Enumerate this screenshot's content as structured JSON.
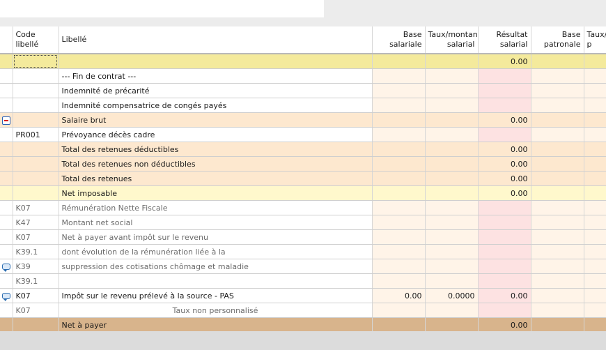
{
  "colors": {
    "summary_yellow_row": "#f4ea9c",
    "total_row_peach": "#fde8cf",
    "net_imposable_row": "#fff8cc",
    "net_a_payer_row": "#d8b48c",
    "base_col_tint": "#fff4e8",
    "result_col_pink": "#fde2e2"
  },
  "columns": [
    {
      "label": "Code\nlibellé"
    },
    {
      "label": "Libellé"
    },
    {
      "label": "Base\nsalariale"
    },
    {
      "label": "Taux/montant\nsalarial"
    },
    {
      "label": "Résultat\nsalarial"
    },
    {
      "label": "Base\npatronale"
    },
    {
      "label": "Taux/m\np"
    }
  ],
  "rows": [
    {
      "icon": "",
      "code": "",
      "label": "",
      "base_sal": "",
      "taux_sal": "",
      "result_sal": "0.00",
      "style": "summary-yellow",
      "label_align": "left"
    },
    {
      "icon": "",
      "code": "",
      "label": "--- Fin de contrat ---",
      "base_sal": "",
      "taux_sal": "",
      "result_sal": "",
      "style": "normal",
      "label_align": "left"
    },
    {
      "icon": "",
      "code": "",
      "label": "Indemnité de précarité",
      "base_sal": "",
      "taux_sal": "",
      "result_sal": "",
      "style": "normal",
      "label_align": "left"
    },
    {
      "icon": "",
      "code": "",
      "label": "Indemnité compensatrice de congés payés",
      "base_sal": "",
      "taux_sal": "",
      "result_sal": "",
      "style": "normal",
      "label_align": "left"
    },
    {
      "icon": "collapse-icon",
      "code": "",
      "label": "Salaire brut",
      "base_sal": "",
      "taux_sal": "",
      "result_sal": "0.00",
      "style": "total",
      "label_align": "left"
    },
    {
      "icon": "",
      "code": "PR001",
      "label": "Prévoyance décès cadre",
      "base_sal": "",
      "taux_sal": "",
      "result_sal": "",
      "style": "normal",
      "label_align": "left"
    },
    {
      "icon": "",
      "code": "",
      "label": "Total des retenues déductibles",
      "base_sal": "",
      "taux_sal": "",
      "result_sal": "0.00",
      "style": "total",
      "label_align": "left"
    },
    {
      "icon": "",
      "code": "",
      "label": "Total des retenues non déductibles",
      "base_sal": "",
      "taux_sal": "",
      "result_sal": "0.00",
      "style": "total",
      "label_align": "left"
    },
    {
      "icon": "",
      "code": "",
      "label": "Total des retenues",
      "base_sal": "",
      "taux_sal": "",
      "result_sal": "0.00",
      "style": "total",
      "label_align": "left"
    },
    {
      "icon": "",
      "code": "",
      "label": "Net imposable",
      "base_sal": "",
      "taux_sal": "",
      "result_sal": "0.00",
      "style": "net-imposable",
      "label_align": "left"
    },
    {
      "icon": "",
      "code": "K07",
      "label": "Rémunération Nette Fiscale",
      "base_sal": "",
      "taux_sal": "",
      "result_sal": "",
      "style": "grey",
      "label_align": "left"
    },
    {
      "icon": "",
      "code": "K47",
      "label": "Montant net social",
      "base_sal": "",
      "taux_sal": "",
      "result_sal": "",
      "style": "grey",
      "label_align": "left"
    },
    {
      "icon": "",
      "code": "K07",
      "label": "Net à payer avant impôt sur le revenu",
      "base_sal": "",
      "taux_sal": "",
      "result_sal": "",
      "style": "grey",
      "label_align": "left"
    },
    {
      "icon": "",
      "code": "K39.1",
      "label": "dont évolution de la rémunération liée à la",
      "base_sal": "",
      "taux_sal": "",
      "result_sal": "",
      "style": "grey",
      "label_align": "left"
    },
    {
      "icon": "comment-icon",
      "code": "K39",
      "label": "suppression des cotisations chômage et maladie",
      "base_sal": "",
      "taux_sal": "",
      "result_sal": "",
      "style": "grey",
      "label_align": "left"
    },
    {
      "icon": "",
      "code": "K39.1",
      "label": "",
      "base_sal": "",
      "taux_sal": "",
      "result_sal": "",
      "style": "grey",
      "label_align": "left"
    },
    {
      "icon": "comment-icon",
      "code": "K07",
      "label": "Impôt sur le revenu prélevé à la source - PAS",
      "base_sal": "0.00",
      "taux_sal": "0.0000",
      "result_sal": "0.00",
      "style": "normal",
      "label_align": "left"
    },
    {
      "icon": "",
      "code": "K07",
      "label": "Taux non personnalisé",
      "base_sal": "",
      "taux_sal": "",
      "result_sal": "",
      "style": "grey",
      "label_align": "center"
    },
    {
      "icon": "",
      "code": "",
      "label": "Net à payer",
      "base_sal": "",
      "taux_sal": "",
      "result_sal": "0.00",
      "style": "net-a-payer",
      "label_align": "left"
    }
  ]
}
